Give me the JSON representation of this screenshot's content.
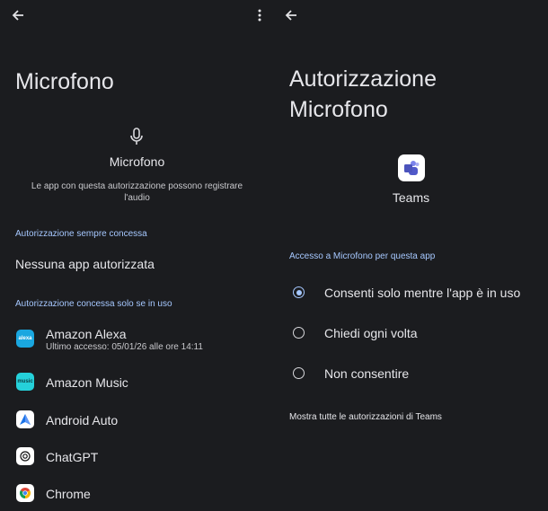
{
  "left": {
    "title": "Microfono",
    "header_icon": "microphone-icon",
    "perm_name": "Microfono",
    "description_line1": "Le app con questa autorizzazione possono registrare",
    "description_line2": "l'audio",
    "section_always": "Autorizzazione sempre concessa",
    "no_apps": "Nessuna app autorizzata",
    "section_in_use": "Autorizzazione concessa solo se in uso",
    "apps": [
      {
        "name": "Amazon Alexa",
        "sub": "Ultimo accesso: 05/01/26 alle ore 14:11",
        "icon": "alexa-icon",
        "icon_text": "alexa",
        "color": "#1aa7e0"
      },
      {
        "name": "Amazon Music",
        "sub": "",
        "icon": "amazon-music-icon",
        "icon_text": "music",
        "color": "#25d1da"
      },
      {
        "name": "Android Auto",
        "sub": "",
        "icon": "android-auto-icon",
        "icon_text": "",
        "color": "#ffffff"
      },
      {
        "name": "ChatGPT",
        "sub": "",
        "icon": "chatgpt-icon",
        "icon_text": "",
        "color": "#ffffff"
      },
      {
        "name": "Chrome",
        "sub": "",
        "icon": "chrome-icon",
        "icon_text": "",
        "color": "#ffffff"
      }
    ]
  },
  "right": {
    "title_line1": "Autorizzazione",
    "title_line2": "Microfono",
    "app_name": "Teams",
    "app_icon": "teams-icon",
    "app_color": "#7b83eb",
    "section": "Accesso a Microfono per questa app",
    "options": [
      {
        "label": "Consenti solo mentre l'app è in uso",
        "selected": true
      },
      {
        "label": "Chiedi ogni volta",
        "selected": false
      },
      {
        "label": "Non consentire",
        "selected": false
      }
    ],
    "show_all": "Mostra tutte le autorizzazioni di Teams"
  },
  "colors": {
    "background": "#1b1c1f",
    "accent": "#a6c8ff",
    "text": "#e6e6ea"
  }
}
